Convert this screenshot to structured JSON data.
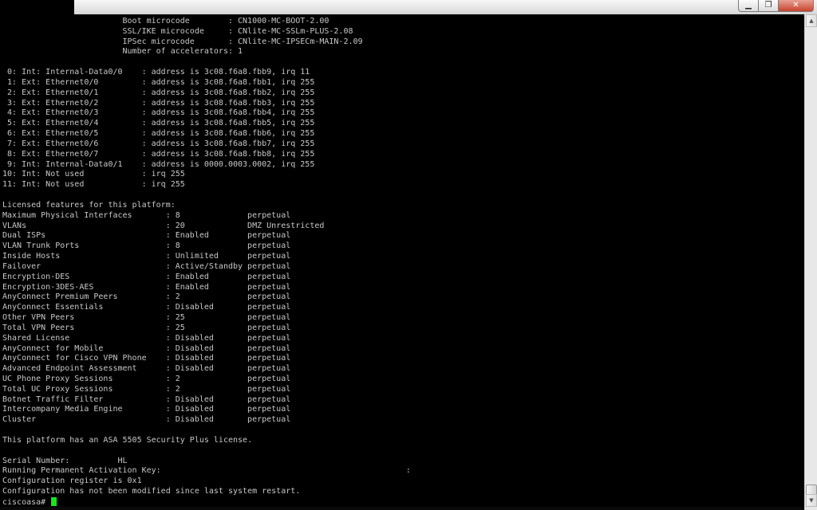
{
  "window": {
    "controls": {
      "minimize": "▁",
      "maximize": "❐",
      "close": "✕"
    }
  },
  "terminal": {
    "lines": [
      "                         Boot microcode        : CN1000-MC-BOOT-2.00",
      "                         SSL/IKE microcode     : CNlite-MC-SSLm-PLUS-2.08",
      "                         IPSec microcode       : CNlite-MC-IPSECm-MAIN-2.09",
      "                         Number of accelerators: 1",
      "",
      " 0: Int: Internal-Data0/0    : address is 3c08.f6a8.fbb9, irq 11",
      " 1: Ext: Ethernet0/0         : address is 3c08.f6a8.fbb1, irq 255",
      " 2: Ext: Ethernet0/1         : address is 3c08.f6a8.fbb2, irq 255",
      " 3: Ext: Ethernet0/2         : address is 3c08.f6a8.fbb3, irq 255",
      " 4: Ext: Ethernet0/3         : address is 3c08.f6a8.fbb4, irq 255",
      " 5: Ext: Ethernet0/4         : address is 3c08.f6a8.fbb5, irq 255",
      " 6: Ext: Ethernet0/5         : address is 3c08.f6a8.fbb6, irq 255",
      " 7: Ext: Ethernet0/6         : address is 3c08.f6a8.fbb7, irq 255",
      " 8: Ext: Ethernet0/7         : address is 3c08.f6a8.fbb8, irq 255",
      " 9: Int: Internal-Data0/1    : address is 0000.0003.0002, irq 255",
      "10: Int: Not used            : irq 255",
      "11: Int: Not used            : irq 255",
      "",
      "Licensed features for this platform:",
      "Maximum Physical Interfaces       : 8              perpetual",
      "VLANs                             : 20             DMZ Unrestricted",
      "Dual ISPs                         : Enabled        perpetual",
      "VLAN Trunk Ports                  : 8              perpetual",
      "Inside Hosts                      : Unlimited      perpetual",
      "Failover                          : Active/Standby perpetual",
      "Encryption-DES                    : Enabled        perpetual",
      "Encryption-3DES-AES               : Enabled        perpetual",
      "AnyConnect Premium Peers          : 2              perpetual",
      "AnyConnect Essentials             : Disabled       perpetual",
      "Other VPN Peers                   : 25             perpetual",
      "Total VPN Peers                   : 25             perpetual",
      "Shared License                    : Disabled       perpetual",
      "AnyConnect for Mobile             : Disabled       perpetual",
      "AnyConnect for Cisco VPN Phone    : Disabled       perpetual",
      "Advanced Endpoint Assessment      : Disabled       perpetual",
      "UC Phone Proxy Sessions           : 2              perpetual",
      "Total UC Proxy Sessions           : 2              perpetual",
      "Botnet Traffic Filter             : Disabled       perpetual",
      "Intercompany Media Engine         : Disabled       perpetual",
      "Cluster                           : Disabled       perpetual",
      "",
      "This platform has an ASA 5505 Security Plus license.",
      "",
      "Serial Number:          HL",
      "Running Permanent Activation Key:                                                   :",
      "Configuration register is 0x1",
      "Configuration has not been modified since last system restart."
    ],
    "prompt": "ciscoasa# "
  },
  "scrollbar": {
    "up_arrow": "▲",
    "down_arrow": "▼"
  },
  "colors": {
    "terminal_bg": "#000000",
    "terminal_fg": "#c8c8c8",
    "cursor": "#19e619",
    "close_button": "#c7432d"
  }
}
